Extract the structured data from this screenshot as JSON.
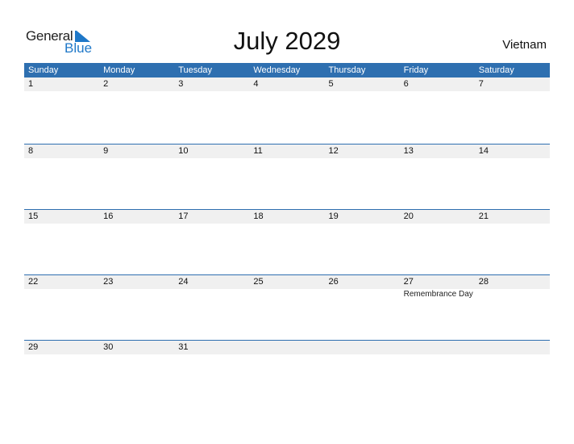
{
  "logo": {
    "general": "General",
    "blue": "Blue",
    "accent_color": "#1f78c8"
  },
  "title": "July 2029",
  "country": "Vietnam",
  "header_color": "#2e6fb0",
  "weekdays": [
    "Sunday",
    "Monday",
    "Tuesday",
    "Wednesday",
    "Thursday",
    "Friday",
    "Saturday"
  ],
  "weeks": [
    {
      "days": [
        "1",
        "2",
        "3",
        "4",
        "5",
        "6",
        "7"
      ],
      "events": [
        "",
        "",
        "",
        "",
        "",
        "",
        ""
      ]
    },
    {
      "days": [
        "8",
        "9",
        "10",
        "11",
        "12",
        "13",
        "14"
      ],
      "events": [
        "",
        "",
        "",
        "",
        "",
        "",
        ""
      ]
    },
    {
      "days": [
        "15",
        "16",
        "17",
        "18",
        "19",
        "20",
        "21"
      ],
      "events": [
        "",
        "",
        "",
        "",
        "",
        "",
        ""
      ]
    },
    {
      "days": [
        "22",
        "23",
        "24",
        "25",
        "26",
        "27",
        "28"
      ],
      "events": [
        "",
        "",
        "",
        "",
        "",
        "Remembrance Day",
        ""
      ]
    },
    {
      "days": [
        "29",
        "30",
        "31",
        "",
        "",
        "",
        ""
      ],
      "events": [
        "",
        "",
        "",
        "",
        "",
        "",
        ""
      ]
    }
  ]
}
